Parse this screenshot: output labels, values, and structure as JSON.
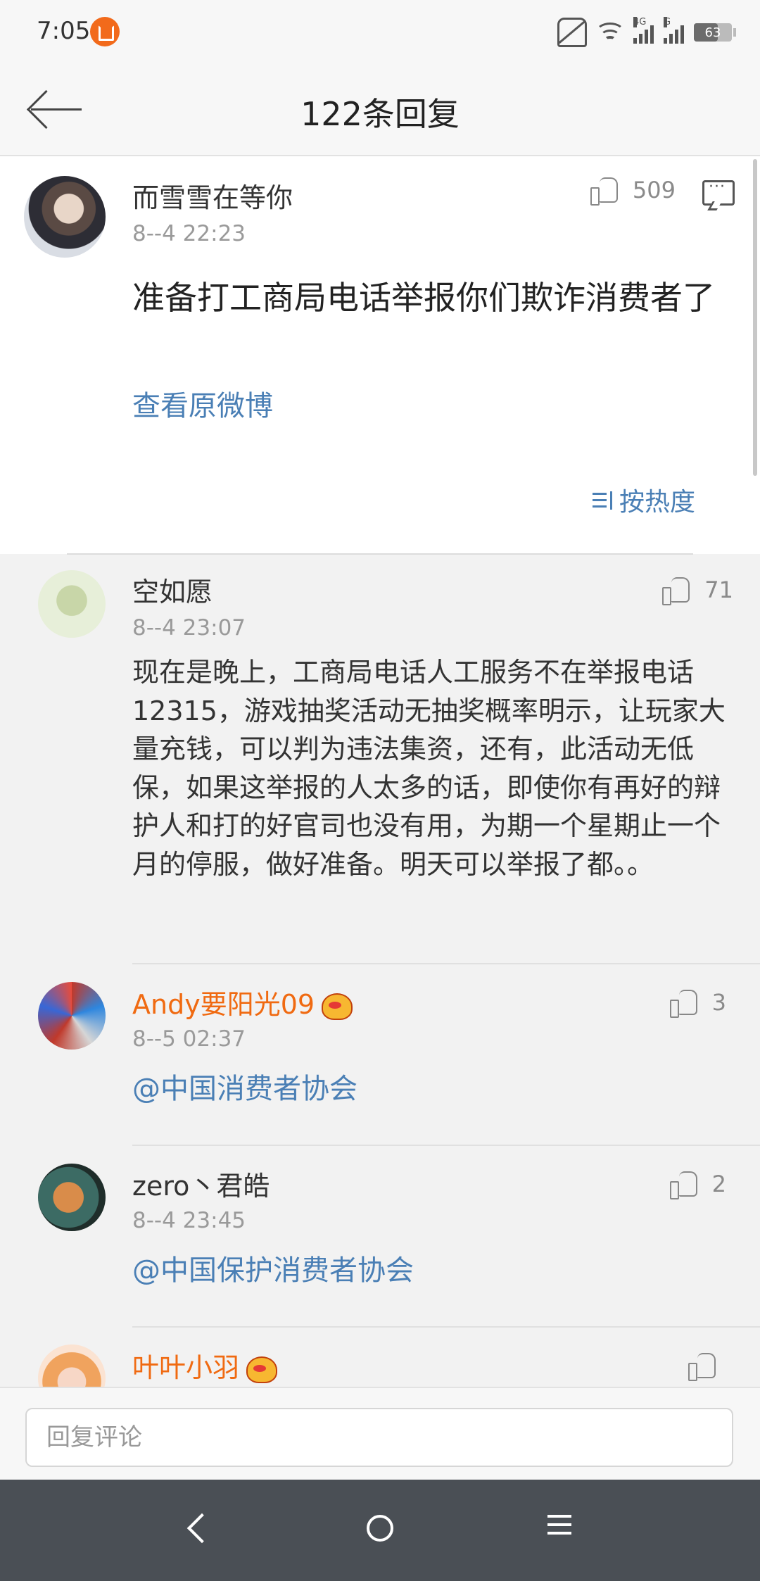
{
  "status_bar": {
    "time": "7:05",
    "network_label": "4G",
    "signal_label": "G",
    "battery": "63"
  },
  "header": {
    "title": "122条回复"
  },
  "original_comment": {
    "username": "而雪雪在等你",
    "time": "8--4 22:23",
    "likes": "509",
    "text": "准备打工商局电话举报你们欺诈消费者了",
    "view_original": "查看原微博",
    "sort_label": "按热度"
  },
  "replies": [
    {
      "username": "空如愿",
      "time": "8--4 23:07",
      "likes": "71",
      "text": "现在是晚上，工商局电话人工服务不在举报电话12315，游戏抽奖活动无抽奖概率明示，让玩家大量充钱，可以判为违法集资，还有，此活动无低保，如果这举报的人太多的话，即使你有再好的辩护人和打的好官司也没有用，为期一个星期止一个月的停服，做好准备。明天可以举报了都。。"
    },
    {
      "username": "Andy要阳光09",
      "time": "8--5 02:37",
      "likes": "3",
      "text": "@中国消费者协会",
      "vip": true
    },
    {
      "username": "zero丶君皓",
      "time": "8--4 23:45",
      "likes": "2",
      "text": "@中国保护消费者协会"
    },
    {
      "username": "叶叶小羽",
      "vip": true
    }
  ],
  "reply_input": {
    "placeholder": "回复评论"
  },
  "colors": {
    "link": "#4a7fb5",
    "vip_name": "#f06a11",
    "nav_bar": "#4a4f55"
  }
}
